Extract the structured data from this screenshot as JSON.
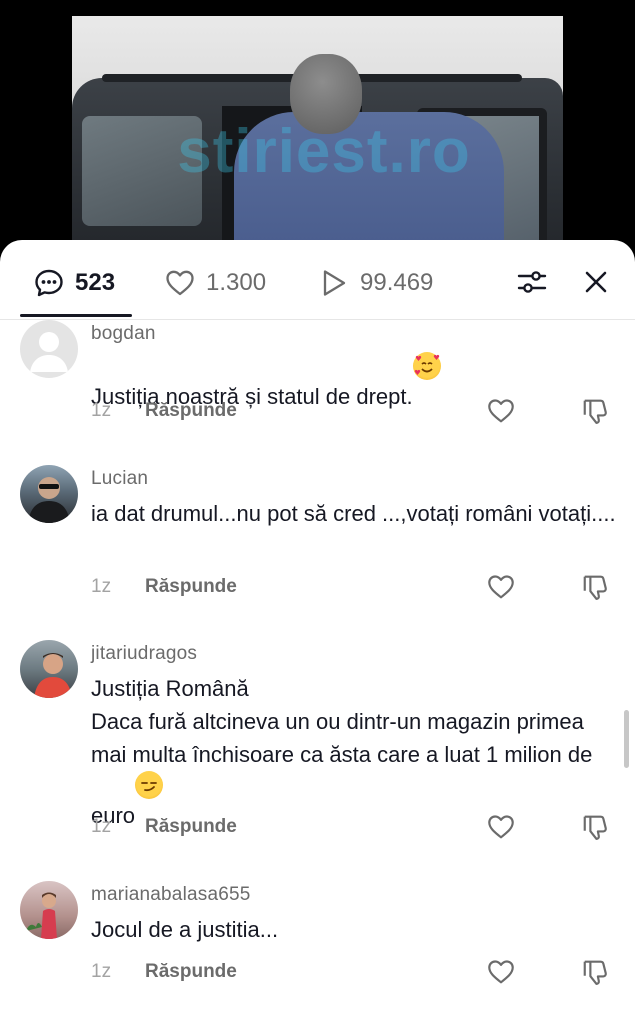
{
  "video": {
    "watermark": "stiriest.ro"
  },
  "tabs": {
    "comments_count": "523",
    "likes_count": "1.300",
    "views_count": "99.469"
  },
  "comments": [
    {
      "username": "bogdan",
      "text": "Justiția noastră și statul de drept.",
      "emoji": "smiling-face-with-hearts",
      "time": "1z",
      "reply_label": "Răspunde"
    },
    {
      "username": "Lucian",
      "text": "ia dat drumul...nu pot să cred ...,votați români votați....",
      "time": "1z",
      "reply_label": "Răspunde"
    },
    {
      "username": "jitariudragos",
      "text": "Justiția Română\nDaca fură altcineva un ou dintr-un magazin primea mai multa închisoare ca ăsta care a luat 1 milion de euro",
      "emoji": "smirking-face",
      "time": "1z",
      "reply_label": "Răspunde"
    },
    {
      "username": "marianabalasa655",
      "text": "Jocul de a justitia...",
      "time": "1z",
      "reply_label": "Răspunde"
    }
  ],
  "colors": {
    "text_primary": "#161823",
    "text_secondary": "#6b6b6b",
    "text_muted": "#a3a3a3",
    "watermark": "#3cc8eb"
  }
}
